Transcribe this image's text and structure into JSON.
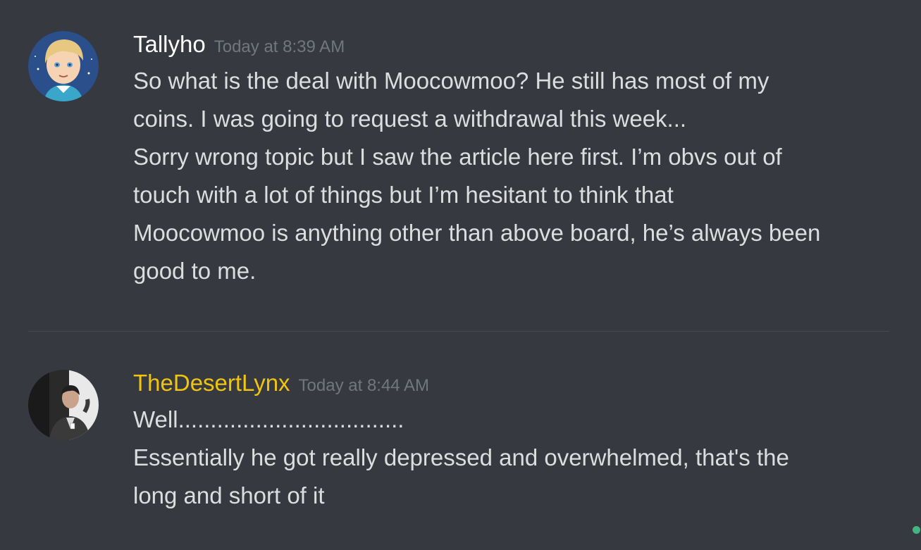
{
  "messages": [
    {
      "username": "Tallyho",
      "username_color": "#ffffff",
      "timestamp": "Today at 8:39 AM",
      "avatar_icon": "cartoon-blond-boy-avatar",
      "lines": [
        "So what is the deal with Moocowmoo?  He still has most of my",
        "coins. I was going to request a withdrawal this week...",
        "Sorry wrong topic but I saw the article here first. I’m obvs out of",
        "touch with a lot of things but I’m hesitant to think that",
        "Moocowmoo is anything other than above board, he’s always been",
        "good to me."
      ]
    },
    {
      "username": "TheDesertLynx",
      "username_color": "#f1c40f",
      "timestamp": "Today at 8:44 AM",
      "avatar_icon": "photo-man-in-suit-avatar",
      "lines": [
        "Well...................................",
        "Essentially he got really depressed and overwhelmed, that's the",
        "long and short of it"
      ]
    }
  ],
  "colors": {
    "background": "#36393f",
    "text": "#dcddde",
    "timestamp": "#72767d",
    "online": "#43b581"
  }
}
